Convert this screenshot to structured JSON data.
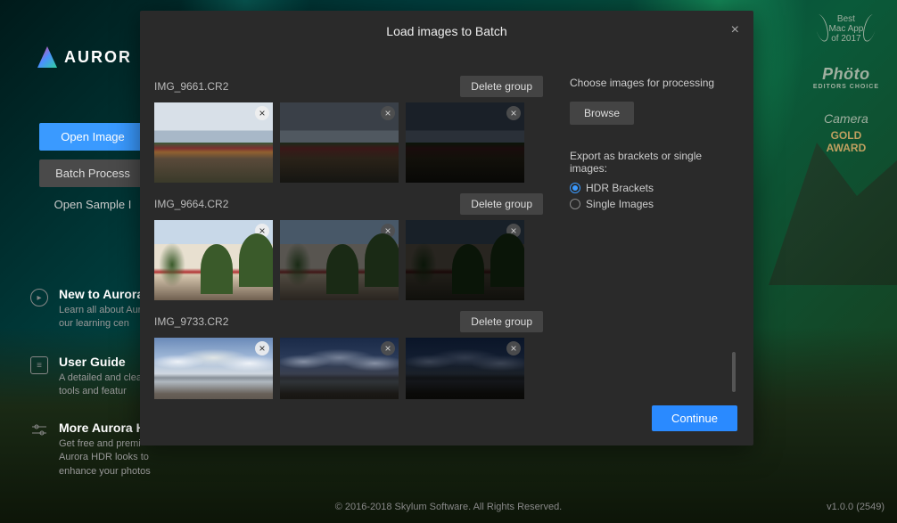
{
  "logo_text": "AUROR",
  "sidebar": {
    "open_image": "Open Image",
    "batch_process": "Batch Process",
    "open_sample": "Open Sample I"
  },
  "help": [
    {
      "title": "New to Aurora H",
      "desc": "Learn all about Aur  in our learning cen"
    },
    {
      "title": "User Guide",
      "desc": "A detailed and clea  to tools and featur"
    },
    {
      "title": "More Aurora HD",
      "desc": "Get free and premi  Aurora HDR looks to enhance your photos"
    }
  ],
  "awards": {
    "best": "Best\nMac App\nof 2017",
    "photo": "Phöto",
    "photo_sub": "EDITORS CHOICE",
    "camera": "Camera",
    "gold": "GOLD\nAWARD"
  },
  "modal": {
    "title": "Load images to Batch",
    "right": {
      "choose_label": "Choose images for processing",
      "browse": "Browse",
      "export_label": "Export as brackets or single images:",
      "opt_hdr": "HDR Brackets",
      "opt_single": "Single Images"
    },
    "groups": [
      {
        "name": "IMG_9661.CR2",
        "delete": "Delete group"
      },
      {
        "name": "IMG_9664.CR2",
        "delete": "Delete group"
      },
      {
        "name": "IMG_9733.CR2",
        "delete": "Delete group"
      }
    ],
    "continue": "Continue"
  },
  "footer": "© 2016-2018 Skylum Software. All Rights Reserved.",
  "version": "v1.0.0 (2549)"
}
